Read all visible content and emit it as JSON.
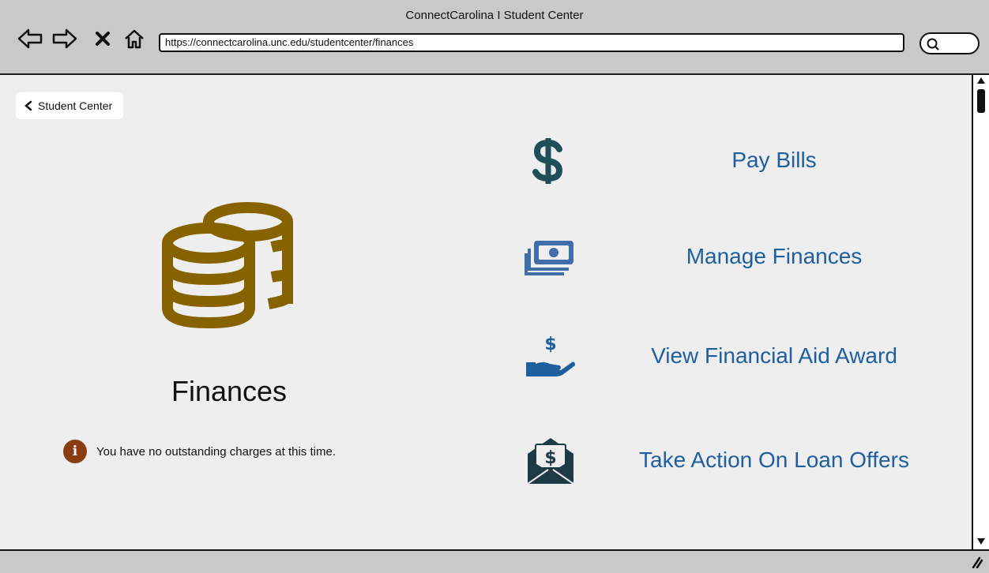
{
  "window": {
    "title": "ConnectCarolina I Student Center"
  },
  "browser": {
    "url": "https://connectcarolina.unc.edu/studentcenter/finances"
  },
  "nav": {
    "back_label": "Student Center"
  },
  "finances": {
    "title": "Finances",
    "notice": "You have no outstanding charges at this time."
  },
  "actions": [
    {
      "label": "Pay Bills",
      "icon": "dollar-icon"
    },
    {
      "label": "Manage Finances",
      "icon": "money-bills-icon"
    },
    {
      "label": "View Financial Aid Award",
      "icon": "hand-dollar-icon"
    },
    {
      "label": "Take Action On Loan Offers",
      "icon": "envelope-dollar-icon"
    }
  ],
  "colors": {
    "accent_text": "#1f5fa0",
    "coin_icon": "#866300",
    "dollar_icon": "#1f4f58",
    "info_badge": "#8a3b12"
  }
}
